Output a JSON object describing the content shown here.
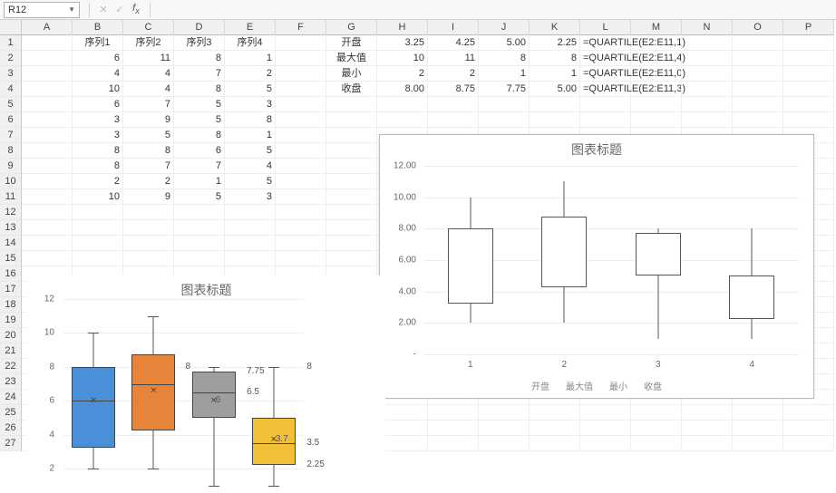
{
  "name_box": "R12",
  "columns": [
    "A",
    "B",
    "C",
    "D",
    "E",
    "F",
    "G",
    "H",
    "I",
    "J",
    "K",
    "L",
    "M",
    "N",
    "O",
    "P"
  ],
  "row_count": 27,
  "grid": {
    "headers_row1": {
      "B": "序列1",
      "C": "序列2",
      "D": "序列3",
      "E": "序列4",
      "G": "开盘",
      "H": "3.25",
      "I": "4.25",
      "J": "5.00",
      "K": "2.25",
      "L": "=QUARTILE(E2:E11,1)"
    },
    "rows": [
      {
        "B": "6",
        "C": "11",
        "D": "8",
        "E": "1",
        "G": "最大值",
        "H": "10",
        "I": "11",
        "J": "8",
        "K": "8",
        "L": "=QUARTILE(E2:E11,4)"
      },
      {
        "B": "4",
        "C": "4",
        "D": "7",
        "E": "2",
        "G": "最小",
        "H": "2",
        "I": "2",
        "J": "1",
        "K": "1",
        "L": "=QUARTILE(E2:E11,0)"
      },
      {
        "B": "10",
        "C": "4",
        "D": "8",
        "E": "5",
        "G": "收盘",
        "H": "8.00",
        "I": "8.75",
        "J": "7.75",
        "K": "5.00",
        "L": "=QUARTILE(E2:E11,3)"
      },
      {
        "B": "6",
        "C": "7",
        "D": "5",
        "E": "3"
      },
      {
        "B": "3",
        "C": "9",
        "D": "5",
        "E": "8"
      },
      {
        "B": "3",
        "C": "5",
        "D": "8",
        "E": "1"
      },
      {
        "B": "8",
        "C": "8",
        "D": "6",
        "E": "5"
      },
      {
        "B": "8",
        "C": "7",
        "D": "7",
        "E": "4"
      },
      {
        "B": "2",
        "C": "2",
        "D": "1",
        "E": "5"
      },
      {
        "B": "10",
        "C": "9",
        "D": "5",
        "E": "3"
      }
    ]
  },
  "chart1": {
    "title": "图表标题",
    "y_ticks": [
      "-",
      "2.00",
      "4.00",
      "6.00",
      "8.00",
      "10.00",
      "12.00"
    ],
    "x_labels": [
      "1",
      "2",
      "3",
      "4"
    ],
    "legend": [
      "开盘",
      "最大值",
      "最小",
      "收盘"
    ],
    "y_min": 0,
    "y_max": 12,
    "stocks": [
      {
        "open": 3.25,
        "high": 10,
        "low": 2,
        "close": 8.0
      },
      {
        "open": 4.25,
        "high": 11,
        "low": 2,
        "close": 8.75
      },
      {
        "open": 5.0,
        "high": 8,
        "low": 1,
        "close": 7.75
      },
      {
        "open": 2.25,
        "high": 8,
        "low": 1,
        "close": 5.0
      }
    ]
  },
  "chart2": {
    "title": "图表标题",
    "y_ticks": [
      "2",
      "4",
      "6",
      "8",
      "10",
      "12"
    ],
    "y_min": 1,
    "y_max": 12,
    "colors": [
      "#4a90d9",
      "#e8833a",
      "#9e9e9e",
      "#f2c037"
    ],
    "series": [
      {
        "min": 2,
        "q1": 3.25,
        "median": 6,
        "q3": 8,
        "max": 10,
        "mean": 6
      },
      {
        "min": 2,
        "q1": 4.25,
        "median": 7,
        "q3": 8.75,
        "max": 11,
        "mean": 6.6
      },
      {
        "min": 1,
        "q1": 5,
        "median": 6.5,
        "q3": 7.75,
        "max": 8,
        "mean": 6
      },
      {
        "min": 1,
        "q1": 2.25,
        "median": 3.5,
        "q3": 5,
        "max": 8,
        "mean": 3.7
      }
    ],
    "labels_right": [
      "8",
      "7.75",
      "6.5",
      "3.5",
      "2.25",
      "8"
    ],
    "labels_inline": [
      "6",
      "3.7"
    ]
  },
  "chart_data": [
    {
      "type": "box",
      "title": "图表标题",
      "series": [
        {
          "name": "序列1",
          "min": 2,
          "q1": 3.25,
          "median": 6,
          "q3": 8,
          "max": 10,
          "mean": 6
        },
        {
          "name": "序列2",
          "min": 2,
          "q1": 4.25,
          "median": 7,
          "q3": 8.75,
          "max": 11,
          "mean": 6.6
        },
        {
          "name": "序列3",
          "min": 1,
          "q1": 5,
          "median": 6.5,
          "q3": 7.75,
          "max": 8,
          "mean": 6
        },
        {
          "name": "序列4",
          "min": 1,
          "q1": 2.25,
          "median": 3.5,
          "q3": 5,
          "max": 8,
          "mean": 3.7
        }
      ],
      "ylim": [
        1,
        12
      ]
    },
    {
      "type": "candlestick",
      "title": "图表标题",
      "categories": [
        "1",
        "2",
        "3",
        "4"
      ],
      "series": [
        {
          "name": "开盘",
          "values": [
            3.25,
            4.25,
            5.0,
            2.25
          ]
        },
        {
          "name": "最大值",
          "values": [
            10,
            11,
            8,
            8
          ]
        },
        {
          "name": "最小",
          "values": [
            2,
            2,
            1,
            1
          ]
        },
        {
          "name": "收盘",
          "values": [
            8.0,
            8.75,
            7.75,
            5.0
          ]
        }
      ],
      "ylim": [
        0,
        12
      ]
    }
  ]
}
